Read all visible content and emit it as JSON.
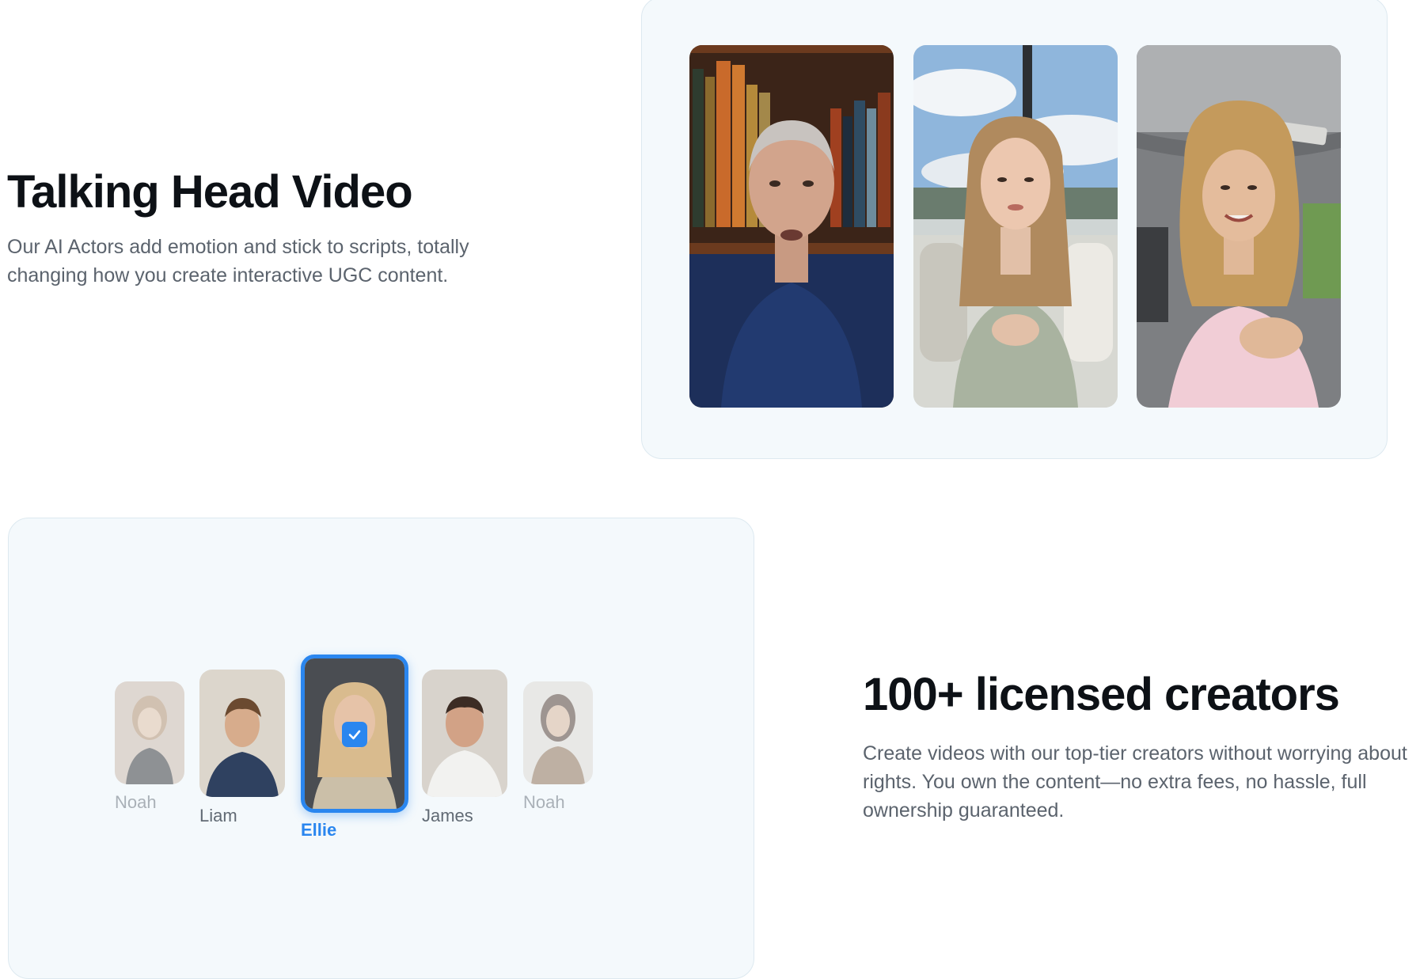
{
  "talking_head": {
    "title": "Talking Head Video",
    "description": "Our AI Actors add emotion and stick to scripts, totally changing how you create interactive UGC content."
  },
  "creators_section": {
    "title": "100+ licensed creators",
    "description": "Create videos with our top-tier creators without worrying about rights. You own the content—no extra fees, no hassle, full ownership guaranteed.",
    "carousel": [
      {
        "name": "Noah",
        "selected": false
      },
      {
        "name": "Liam",
        "selected": false
      },
      {
        "name": "Ellie",
        "selected": true
      },
      {
        "name": "James",
        "selected": false
      },
      {
        "name": "Noah",
        "selected": false
      }
    ]
  },
  "colors": {
    "accent": "#2a86ef",
    "panel_background": "#f4f9fc",
    "heading": "#0d1116",
    "body_text": "#5b636d"
  },
  "icons": {
    "selected_indicator": "check-icon"
  }
}
